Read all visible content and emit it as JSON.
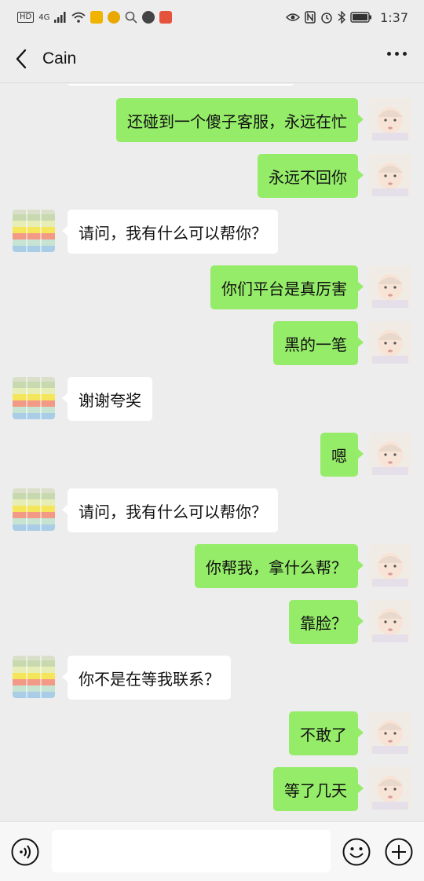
{
  "status_bar": {
    "network_badge": "HD",
    "network_type": "4G",
    "time": "1:37"
  },
  "header": {
    "title": "Cain"
  },
  "messages": [
    {
      "side": "sent",
      "text": "还碰到一个傻子客服，永远在忙"
    },
    {
      "side": "sent",
      "text": "永远不回你"
    },
    {
      "side": "recv",
      "text": "请问，我有什么可以帮你？"
    },
    {
      "side": "sent",
      "text": "你们平台是真厉害"
    },
    {
      "side": "sent",
      "text": "黑的一笔"
    },
    {
      "side": "recv",
      "text": "谢谢夸奖"
    },
    {
      "side": "sent",
      "text": "嗯"
    },
    {
      "side": "recv",
      "text": "请问，我有什么可以帮你？"
    },
    {
      "side": "sent",
      "text": "你帮我，拿什么帮？"
    },
    {
      "side": "sent",
      "text": "靠脸？"
    },
    {
      "side": "recv",
      "text": "你不是在等我联系？"
    },
    {
      "side": "sent",
      "text": "不敢了"
    },
    {
      "side": "sent",
      "text": "等了几天"
    }
  ],
  "input": {
    "value": "",
    "placeholder": ""
  },
  "icons": {
    "back": "chevron-left-icon",
    "more": "more-dots-icon",
    "voice": "voice-icon",
    "emoji": "emoji-icon",
    "plus": "plus-icon"
  },
  "colors": {
    "sent_bubble": "#95ec69",
    "recv_bubble": "#ffffff",
    "background": "#ededed"
  }
}
